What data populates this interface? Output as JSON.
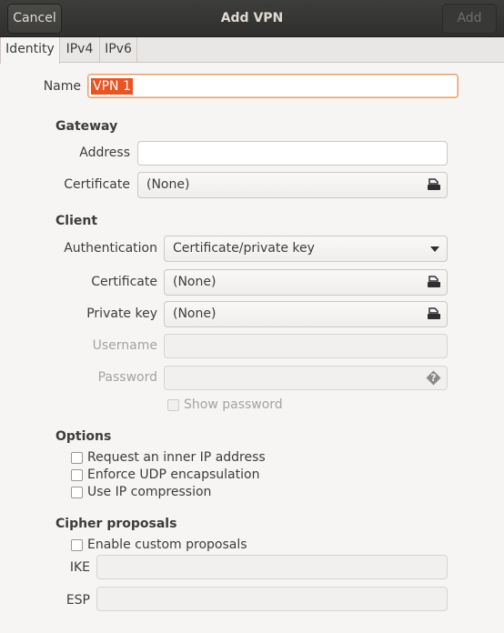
{
  "header": {
    "title": "Add VPN",
    "cancel_label": "Cancel",
    "add_label": "Add"
  },
  "tabs": [
    {
      "label": "Identity",
      "active": true
    },
    {
      "label": "IPv4",
      "active": false
    },
    {
      "label": "IPv6",
      "active": false
    }
  ],
  "identity": {
    "name_label": "Name",
    "name_value": "VPN 1"
  },
  "gateway": {
    "heading": "Gateway",
    "address_label": "Address",
    "address_value": "",
    "certificate_label": "Certificate",
    "certificate_value": "(None)"
  },
  "client": {
    "heading": "Client",
    "authentication_label": "Authentication",
    "authentication_value": "Certificate/private key",
    "certificate_label": "Certificate",
    "certificate_value": "(None)",
    "private_key_label": "Private key",
    "private_key_value": "(None)",
    "username_label": "Username",
    "password_label": "Password",
    "show_password_label": "Show password"
  },
  "options": {
    "heading": "Options",
    "inner_ip_label": "Request an inner IP address",
    "enforce_udp_label": "Enforce UDP encapsulation",
    "ip_compression_label": "Use IP compression"
  },
  "cipher": {
    "heading": "Cipher proposals",
    "enable_custom_label": "Enable custom proposals",
    "ike_label": "IKE",
    "esp_label": "ESP"
  },
  "icons": {
    "file_chooser": "document-open-icon",
    "password_hint": "question-icon",
    "dropdown": "chevron-down-icon"
  }
}
